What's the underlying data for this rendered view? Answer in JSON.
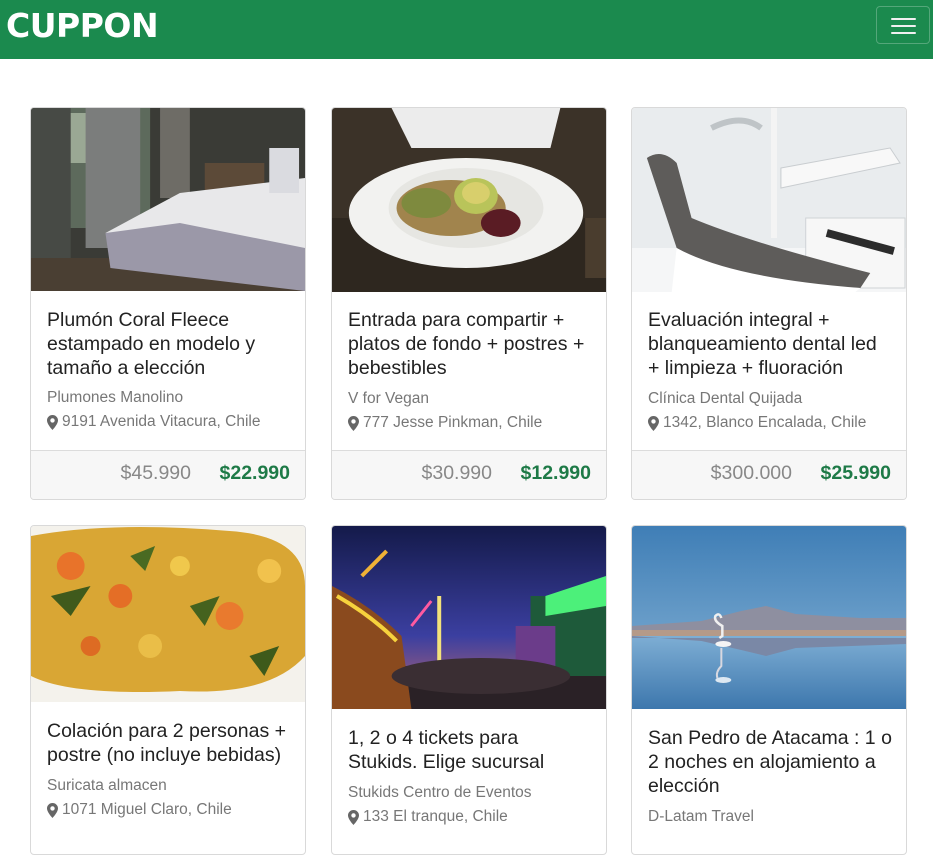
{
  "navbar": {
    "brand": "CUPPON",
    "menu_icon": "hamburger-menu-icon",
    "bg_color": "#1b8a4e"
  },
  "colors": {
    "new_price": "#1e7a47",
    "old_price": "#888888"
  },
  "deals": [
    {
      "title": "Plumón Coral Fleece estampado en modelo y tamaño a elección",
      "vendor": "Plumones Manolino",
      "address": "9191 Avenida Vitacura, Chile",
      "old_price": "$45.990",
      "new_price": "$22.990",
      "image": "bedroom-photo"
    },
    {
      "title": "Entrada para compartir + platos de fondo + postres + bebestibles",
      "vendor": "V for Vegan",
      "address": "777 Jesse Pinkman, Chile",
      "old_price": "$30.990",
      "new_price": "$12.990",
      "image": "salad-plate-photo"
    },
    {
      "title": "Evaluación integral + blanqueamiento dental led + limpieza + fluoración",
      "vendor": "Clínica Dental Quijada",
      "address": "1342, Blanco Encalada, Chile",
      "old_price": "$300.000",
      "new_price": "$25.990",
      "image": "dental-chair-photo"
    },
    {
      "title": "Colación para 2 personas + postre (no incluye bebidas)",
      "vendor": "Suricata almacen",
      "address": "1071 Miguel Claro, Chile",
      "image": "food-dish-photo"
    },
    {
      "title": "1, 2 o 4 tickets para Stukids. Elige sucursal",
      "vendor": "Stukids Centro de Eventos",
      "address": "133 El tranque, Chile",
      "image": "amusement-park-photo"
    },
    {
      "title": "San Pedro de Atacama : 1 o 2 noches en alojamiento a elección",
      "vendor": "D-Latam Travel",
      "image": "flamingo-lake-photo"
    }
  ]
}
